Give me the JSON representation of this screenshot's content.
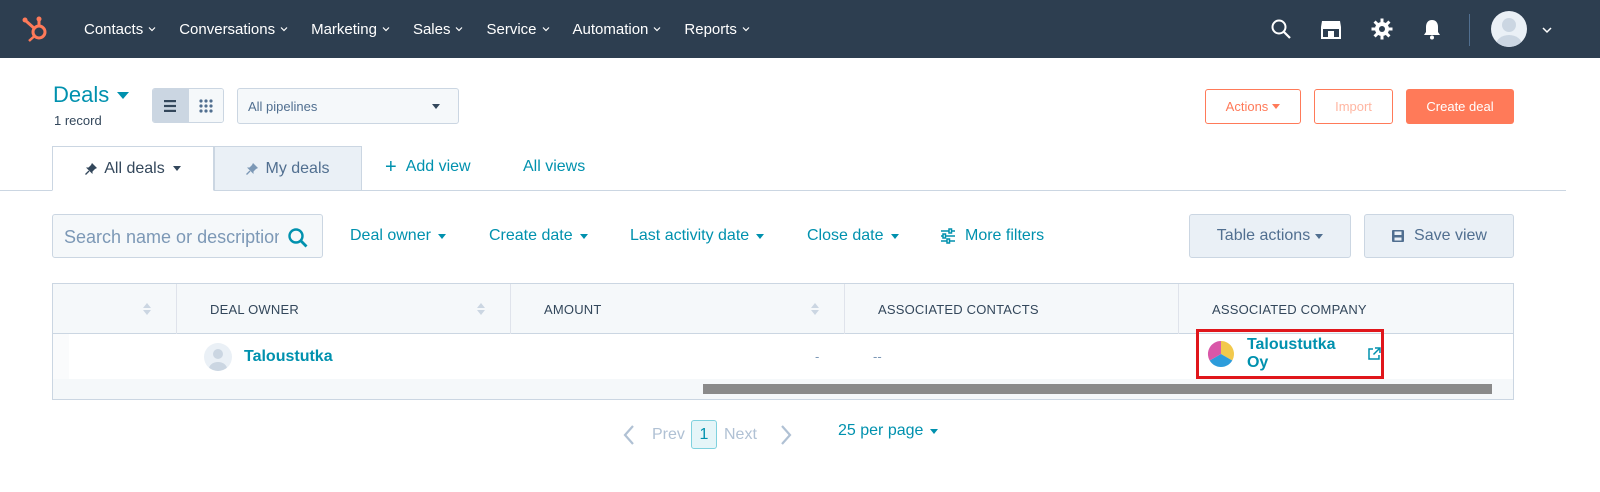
{
  "nav": {
    "items": [
      {
        "label": "Contacts"
      },
      {
        "label": "Conversations"
      },
      {
        "label": "Marketing"
      },
      {
        "label": "Sales"
      },
      {
        "label": "Service"
      },
      {
        "label": "Automation"
      },
      {
        "label": "Reports"
      }
    ],
    "icons": [
      "search-icon",
      "marketplace-icon",
      "gear-icon",
      "bell-icon"
    ],
    "brand_color": "#2d3e50",
    "logo_color": "#ff7a59"
  },
  "header": {
    "title": "Deals",
    "record_count": "1 record",
    "pipeline_select": "All pipelines",
    "actions_label": "Actions",
    "import_label": "Import",
    "create_label": "Create deal"
  },
  "tabs": {
    "all_deals": "All deals",
    "my_deals": "My deals",
    "add_view": "Add view",
    "all_views": "All views"
  },
  "filters": {
    "search_placeholder": "Search name or description",
    "deal_owner": "Deal owner",
    "create_date": "Create date",
    "last_activity_date": "Last activity date",
    "close_date": "Close date",
    "more_filters": "More filters",
    "table_actions": "Table actions",
    "save_view": "Save view"
  },
  "table": {
    "columns": [
      "",
      "DEAL OWNER",
      "AMOUNT",
      "ASSOCIATED CONTACTS",
      "ASSOCIATED COMPANY"
    ],
    "rows": [
      {
        "deal_owner": "Taloustutka",
        "amount": "-",
        "contacts": "--",
        "company": "Taloustutka Oy"
      }
    ]
  },
  "pagination": {
    "prev": "Prev",
    "page": "1",
    "next": "Next",
    "per_page": "25 per page"
  },
  "colors": {
    "accent": "#0091ae",
    "primary_button": "#ff7a59",
    "highlight_box": "#e0161b"
  }
}
